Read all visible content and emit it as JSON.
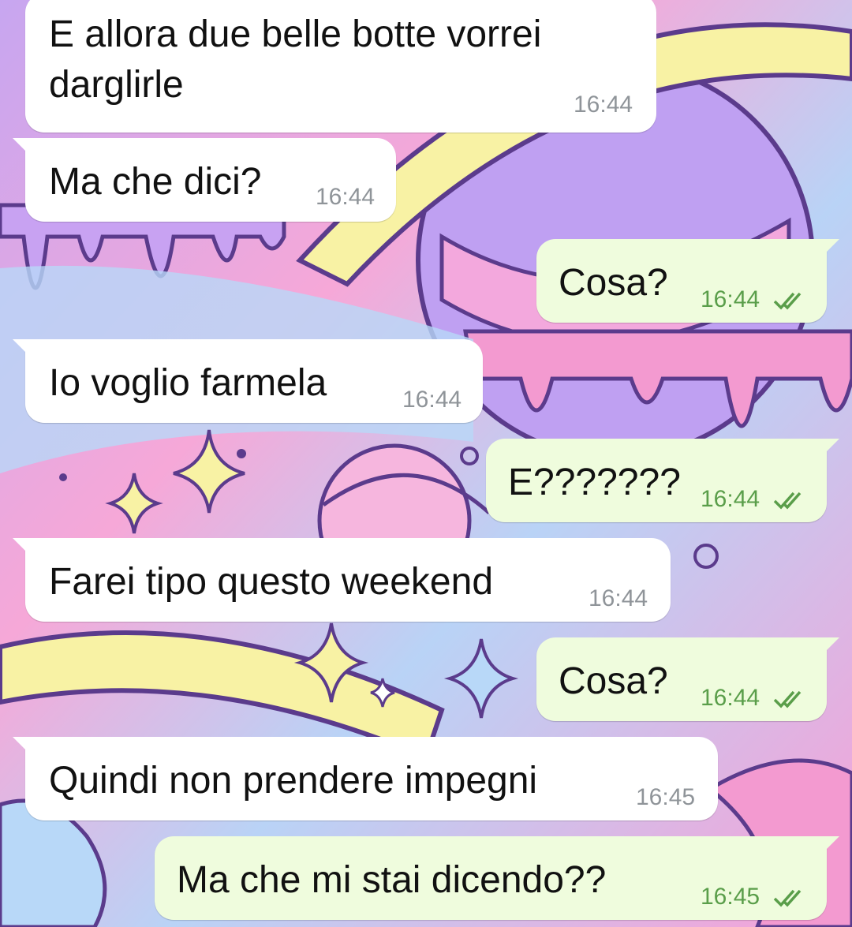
{
  "chat": {
    "messages": [
      {
        "direction": "incoming",
        "text_lines": [
          "E allora due belle botte vorrei",
          "darglirle"
        ],
        "time": "16:44"
      },
      {
        "direction": "incoming",
        "text": "Ma che dici?",
        "time": "16:44"
      },
      {
        "direction": "outgoing",
        "text": "Cosa?",
        "time": "16:44",
        "status": "read-double-check-icon"
      },
      {
        "direction": "incoming",
        "text": "Io voglio farmela",
        "time": "16:44"
      },
      {
        "direction": "outgoing",
        "text": "E???????",
        "time": "16:44",
        "status": "read-double-check-icon"
      },
      {
        "direction": "incoming",
        "text": "Farei tipo questo weekend",
        "time": "16:44"
      },
      {
        "direction": "outgoing",
        "text": "Cosa?",
        "time": "16:44",
        "status": "read-double-check-icon"
      },
      {
        "direction": "incoming",
        "text": "Quindi non prendere impegni",
        "time": "16:45"
      },
      {
        "direction": "outgoing",
        "text": "Ma che mi stai dicendo??",
        "time": "16:45",
        "status": "read-double-check-icon"
      }
    ]
  },
  "colors": {
    "incoming_bubble": "#ffffff",
    "outgoing_bubble": "#effcdd",
    "incoming_time": "#8f9499",
    "outgoing_time": "#5a9e4a",
    "check_marks": "#5a9e4a"
  }
}
